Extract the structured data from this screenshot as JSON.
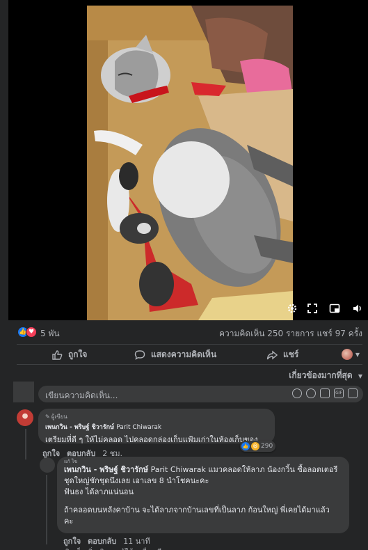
{
  "video": {
    "controls": [
      "gear-icon",
      "fullscreen-icon",
      "picture-in-picture-icon",
      "volume-icon"
    ]
  },
  "reactions": {
    "count": "5 พัน",
    "stats": "ความคิดเห็น 250 รายการ  แชร์ 97 ครั้ง",
    "colors": {
      "like": "#1877f2",
      "love": "#f33e58",
      "haha": "#f7b125"
    }
  },
  "actions": {
    "like": "ถูกใจ",
    "comment": "แสดงความคิดเห็น",
    "share": "แชร์"
  },
  "comments": {
    "sort_label": "เกี่ยวข้องมากที่สุด",
    "write_placeholder": "เขียนความคิดเห็น...",
    "items": [
      {
        "badge": "ผู้เขียน",
        "author": "เพนกวิน - พริษฐ์ ชิวารักษ์",
        "author_en": "Parit Chiwarak",
        "text": "เตรียมที่ดี ๆ ให้ไม่คลอด ไปคลอดกล่องเก็บแฟ้มเก่าในห้องเก็บของ...",
        "reaction_count": "290",
        "like": "ถูกใจ",
        "reply": "ตอบกลับ",
        "time": "2 ชม."
      },
      {
        "header": "แก้ ไข",
        "author": "เพนกวิน - พริษฐ์ ชิวารักษ์",
        "author_en": "Parit Chiwarak",
        "lines": [
          "แมวคลอดให้ลาภ น้องกวิ้น ซื้อลอตเตอรี",
          "ชุดใหญ่ชักชุดนึงเลย เอาเลข 8 นำโชคนะคะ",
          "ฟันธง ได้ลาภแน่นอน",
          "ถ้าคลอดบนหลังคาบ้าน จะได้ลาภจากบ้านเลขที่เป็นลาภ ก้อนใหญ่ พี่เคยได้มาแล้ว",
          "คะ"
        ],
        "like": "ถูกใจ",
        "reply": "ตอบกลับ",
        "time": "11 นาที"
      }
    ],
    "next_preview": "ดูความคิดเห็นเพิ่มเติมจากผู้ใช้คนอื่นๆ อีกหลายรายการ"
  }
}
